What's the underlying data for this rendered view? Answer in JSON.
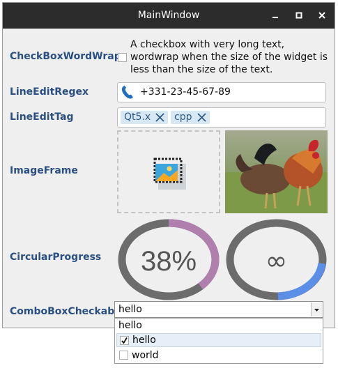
{
  "window": {
    "title": "MainWindow"
  },
  "labels": {
    "checkbox_wordwrap": "CheckBoxWordWrap",
    "lineedit_regex": "LineEditRegex",
    "lineedit_tag": "LineEditTag",
    "image_frame": "ImageFrame",
    "circular_progress": "CircularProgress",
    "combobox_checkable": "ComboBoxCheckable"
  },
  "checkbox": {
    "text": "A checkbox with very long text, wordwrap when the size of the widget is less than the size of the text.",
    "checked": false
  },
  "regex_edit": {
    "value": "+331-23-45-67-89",
    "icon": "phone-icon"
  },
  "tags": [
    "Qt5.x",
    "cpp"
  ],
  "progress": [
    {
      "text": "38%",
      "value": 0.38,
      "color": "#b07fae"
    },
    {
      "text": "∞",
      "value": null,
      "color": "#5b8ee6"
    }
  ],
  "combo": {
    "value": "hello",
    "options": [
      {
        "label": "hello",
        "checked": null
      },
      {
        "label": "hello",
        "checked": true
      },
      {
        "label": "world",
        "checked": false
      }
    ]
  },
  "colors": {
    "label": "#2a4f82",
    "titlebar": "#2c2c2c",
    "tag_bg": "#d7e8f4",
    "selection": "#e6eff7"
  }
}
